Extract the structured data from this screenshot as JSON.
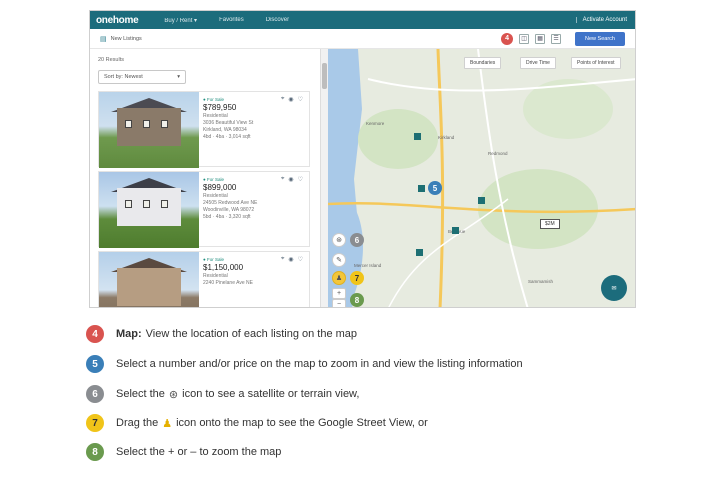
{
  "header": {
    "logo": "onehome",
    "nav": [
      "Buy / Rent ▾",
      "Favorites",
      "Discover"
    ],
    "account": "Activate Account"
  },
  "toolbar": {
    "list_label": "New Listings",
    "new_search": "New Search"
  },
  "listing_panel": {
    "results": "20 Results",
    "sort": "Sort by: Newest",
    "cards": [
      {
        "status": "● For Sale",
        "price": "$789,950",
        "type": "Residential",
        "line1": "3036 Beautiful View St",
        "line2": "Kirkland, WA 98034",
        "line3": "4bd · 4ba · 3,014 sqft"
      },
      {
        "status": "● For Sale",
        "price": "$899,000",
        "type": "Residential",
        "line1": "24505 Redwood Ave NE",
        "line2": "Woodinville, WA 98072",
        "line3": "5bd · 4ba · 3,320 sqft"
      },
      {
        "status": "● For Sale",
        "price": "$1,150,000",
        "type": "Residential",
        "line1": "2240 Pinelane Ave NE",
        "line2": "",
        "line3": ""
      }
    ]
  },
  "map": {
    "buttons": [
      "Boundaries",
      "Drive Time",
      "Points of Interest"
    ],
    "price_pin": "$2M",
    "labels": [
      "Kirkland",
      "Redmond",
      "Bellevue",
      "Sammamish",
      "Mercer Island",
      "Kenmore",
      "Woodinville"
    ]
  },
  "legend": [
    {
      "num": "4",
      "bold": "Map:",
      "text": "View the location of each listing on the map"
    },
    {
      "num": "5",
      "text": "Select a number and/or price on the map to zoom in and view the listing information"
    },
    {
      "num": "6",
      "text_before": "Select the",
      "icon": "layers-icon",
      "text_after": "icon to see a satellite or terrain view,"
    },
    {
      "num": "7",
      "text_before": "Drag the",
      "icon": "pegman-icon",
      "text_after": "icon onto the map to see the Google Street View, or"
    },
    {
      "num": "8",
      "text": "Select the + or – to zoom the map"
    }
  ]
}
